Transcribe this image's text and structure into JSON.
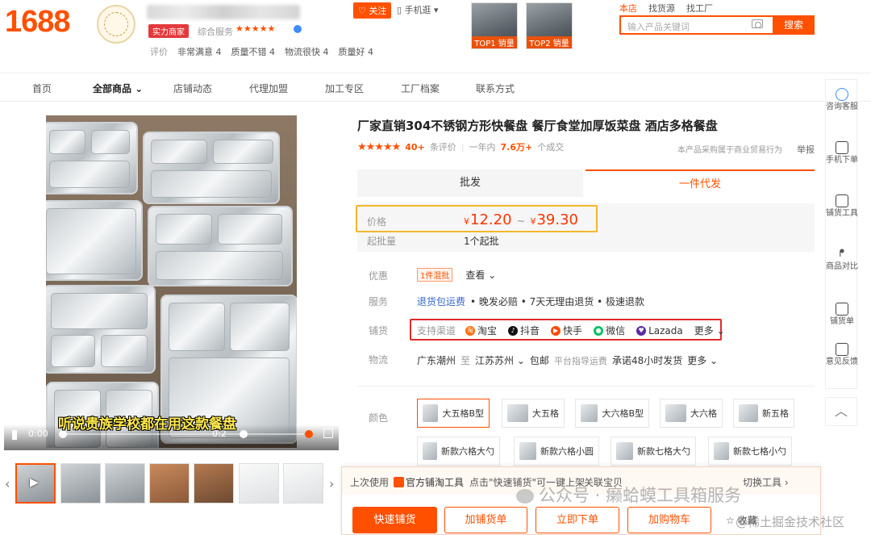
{
  "header": {
    "logo": "1688",
    "badge": "实力商家",
    "service_label": "综合服务",
    "service_stars": "★★★★★",
    "follow": "关注",
    "mobile": "手机逛",
    "eval_label": "评价",
    "evals": [
      "非常满意 4",
      "质量不错 4",
      "物流很快 4",
      "质量好 4"
    ],
    "top_products": [
      "TOP1 销量",
      "TOP2 销量"
    ],
    "search_tabs": [
      "本店",
      "找货源",
      "找工厂"
    ],
    "search_placeholder": "输入产品关键词",
    "search_button": "搜索"
  },
  "nav": {
    "items": [
      "首页",
      "全部商品",
      "店铺动态",
      "代理加盟",
      "加工专区",
      "工厂档案",
      "联系方式"
    ]
  },
  "gallery": {
    "caption": "听说贵族学校都在用这款餐盘",
    "time_current": "0:00",
    "time_total": "0:2"
  },
  "product": {
    "title": "厂家直销304不锈钢方形快餐盘 餐厅食堂加厚饭菜盘 酒店多格餐盘",
    "stars": "★★★★★",
    "review_count": "40+",
    "review_label": "条评价",
    "sales_period": "一年内",
    "sales_count": "7.6万+",
    "sales_unit": "个成交",
    "biz_note": "本产品采购属于商业贸易行为",
    "report": "举报",
    "mode_tabs": [
      "批发",
      "一件代发"
    ],
    "price_label": "价格",
    "currency": "¥",
    "price_low": "12.20",
    "tilde": "~",
    "price_high": "39.30",
    "moq_label": "起批量",
    "moq": "1个起批",
    "promo_label": "优惠",
    "promo_tag": "1件混批",
    "promo_more": "查看",
    "service_label": "服务",
    "service_link": "退货包运费",
    "service_rest": "• 晚发必赔 • 7天无理由退货 • 极速退款",
    "channel_label": "铺货",
    "channel_intro": "支持渠道",
    "channels": [
      "淘宝",
      "抖音",
      "快手",
      "微信",
      "Lazada"
    ],
    "channel_more": "更多",
    "logistics_label": "物流",
    "ship_from": "广东潮州",
    "ship_to_word": "至",
    "ship_to": "江苏苏州",
    "shipping_fee": "包邮",
    "freight_note": "平台指导运费",
    "ship_promise": "承诺48小时发货",
    "logistics_more": "更多",
    "color_label": "颜色",
    "skus": [
      "大五格B型",
      "大五格",
      "大六格B型",
      "大六格",
      "新五格",
      "新款六格大勺",
      "新款六格小圆",
      "新款七格大勺",
      "新款七格小勺"
    ]
  },
  "rail": {
    "items": [
      "咨询客服",
      "手机下单",
      "铺货工具",
      "商品对比",
      "铺货单",
      "意见反馈"
    ]
  },
  "tool_bar": {
    "last_used": "上次使用",
    "tool_name": "官方铺淘工具",
    "hint": "点击\"快速铺货\"可一键上架",
    "related": "关联宝贝",
    "switch": "切换工具 ›",
    "buttons": [
      "快速铺货",
      "加铺货单",
      "立即下单",
      "加购物车"
    ],
    "fav": "☆ 收藏"
  },
  "watermark": {
    "main": "公众号 · 癞蛤蟆工具箱服务",
    "sub": "@稀土掘金技术社区"
  }
}
